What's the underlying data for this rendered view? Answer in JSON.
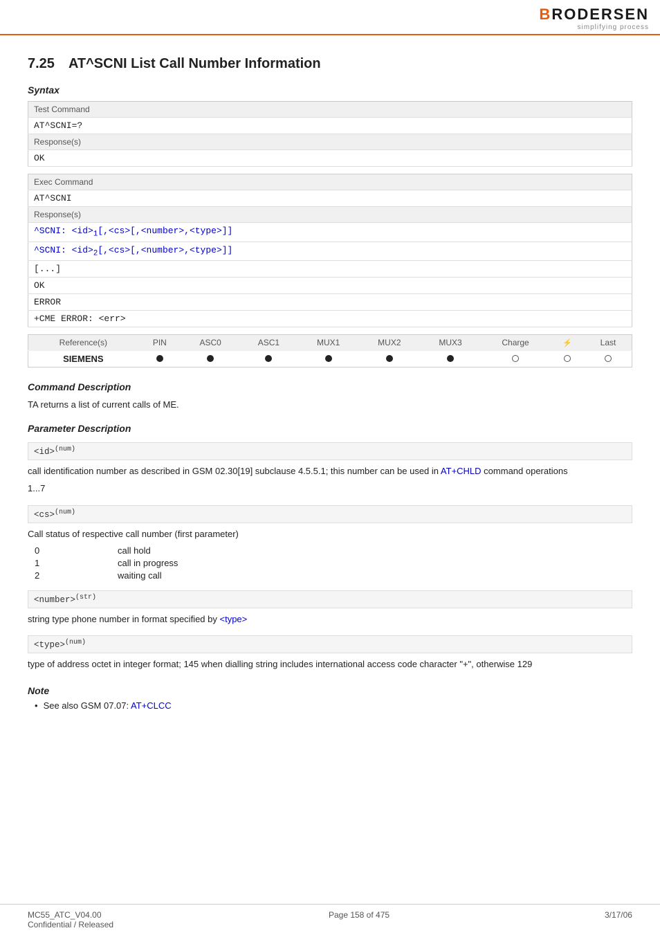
{
  "header": {
    "logo_text": "BRODERSEN",
    "logo_tagline": "simplifying process"
  },
  "section": {
    "number": "7.25",
    "title": "AT^SCNI   List Call Number Information"
  },
  "syntax_label": "Syntax",
  "syntax": {
    "test_command_label": "Test Command",
    "test_command": "AT^SCNI=?",
    "test_response_label": "Response(s)",
    "test_response": "OK",
    "exec_command_label": "Exec Command",
    "exec_command": "AT^SCNI",
    "exec_response_label": "Response(s)",
    "exec_response_line1": "^SCNI: <id>1[,<cs>[,<number>,<type>]]",
    "exec_response_line2": "^SCNI: <id>2[,<cs>[,<number>,<type>]]",
    "exec_response_line3": "[...]",
    "exec_response_line4": "OK",
    "exec_response_line5": "ERROR",
    "exec_response_line6": "+CME ERROR: <err>"
  },
  "reference": {
    "label": "Reference(s)",
    "col_headers": [
      "PIN",
      "ASC0",
      "ASC1",
      "MUX1",
      "MUX2",
      "MUX3",
      "Charge",
      "⚡",
      "Last"
    ],
    "siemens_label": "SIEMENS",
    "dots": [
      "filled",
      "filled",
      "filled",
      "filled",
      "filled",
      "filled",
      "empty",
      "empty",
      "empty"
    ]
  },
  "command_description": {
    "header": "Command Description",
    "text": "TA returns a list of current calls of ME."
  },
  "parameter_description": {
    "header": "Parameter Description",
    "params": [
      {
        "name": "<id>",
        "superscript": "(num)",
        "description": "call identification number as described in GSM 02.30[19] subclause 4.5.5.1; this number can be used in AT+CHLD command operations",
        "link_text": "AT+CHLD",
        "link_href": "AT+CHLD",
        "values_intro": "1...7",
        "values": []
      },
      {
        "name": "<cs>",
        "superscript": "(num)",
        "description": "Call status of respective call number (first parameter)",
        "link_text": "",
        "values": [
          {
            "num": "0",
            "desc": "call hold"
          },
          {
            "num": "1",
            "desc": "call in progress"
          },
          {
            "num": "2",
            "desc": "waiting call"
          }
        ]
      },
      {
        "name": "<number>",
        "superscript": "(str)",
        "description": "string type phone number in format specified by <type>",
        "link_text": "<type>",
        "values": []
      },
      {
        "name": "<type>",
        "superscript": "(num)",
        "description": "type of address octet in integer format; 145 when dialling string includes international access code character \"+\", otherwise 129",
        "link_text": "",
        "values": []
      }
    ]
  },
  "note": {
    "header": "Note",
    "items": [
      {
        "text": "See also GSM 07.07: AT+CLCC",
        "link_text": "AT+CLCC"
      }
    ]
  },
  "footer": {
    "left": "MC55_ATC_V04.00\nConfidential / Released",
    "center": "Page 158 of 475",
    "right": "3/17/06"
  }
}
